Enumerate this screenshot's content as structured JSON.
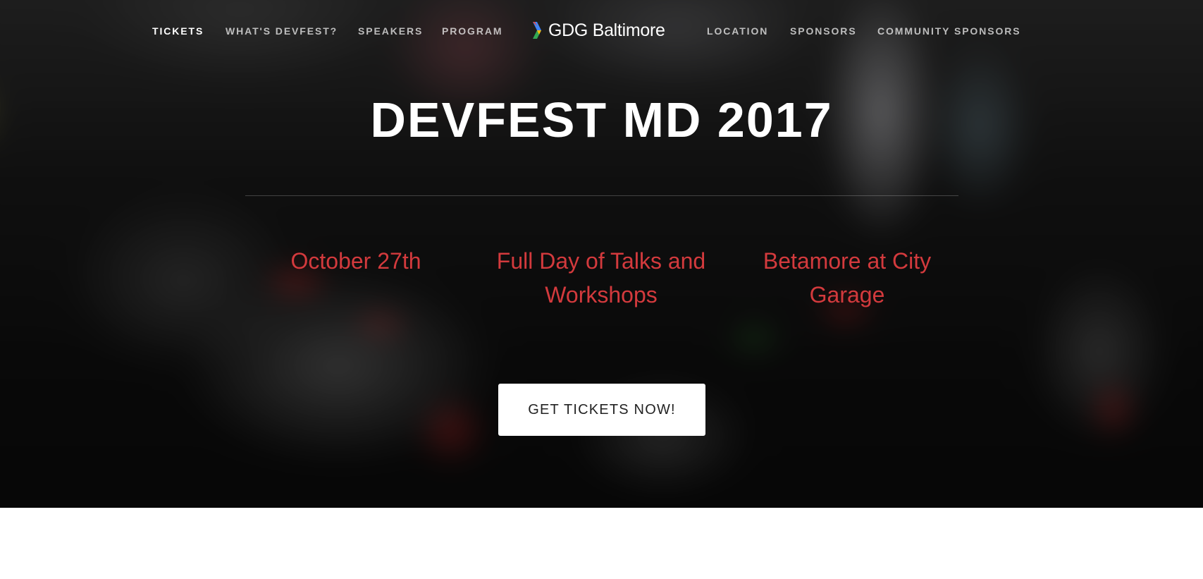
{
  "colors": {
    "accent": "#d33a3d",
    "nav_text": "#ffffff",
    "cta_background": "#ffffff",
    "cta_text": "#222222"
  },
  "nav": {
    "left": [
      {
        "label": "TICKETS",
        "active": true
      },
      {
        "label": "WHAT'S DEVFEST?",
        "active": false
      },
      {
        "label": "SPEAKERS",
        "active": false
      },
      {
        "label": "PROGRAM",
        "active": false
      }
    ],
    "logo": {
      "icon": "gdg-chevron-icon",
      "text_strong": "GDG",
      "text_rest": " Baltimore"
    },
    "right": [
      {
        "label": "LOCATION",
        "active": false
      },
      {
        "label": "SPONSORS",
        "active": false
      },
      {
        "label": "COMMUNITY SPONSORS",
        "active": false
      }
    ]
  },
  "hero": {
    "title": "DEVFEST MD 2017",
    "features": [
      {
        "text": "October 27th"
      },
      {
        "text": "Full Day of Talks and Workshops"
      },
      {
        "text": "Betamore at City Garage"
      }
    ],
    "cta_label": "GET TICKETS NOW!"
  }
}
